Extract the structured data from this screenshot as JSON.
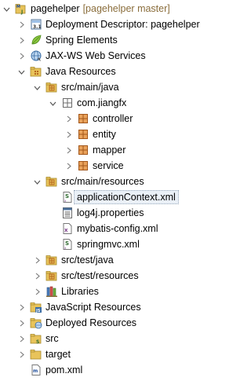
{
  "project": {
    "name": "pagehelper",
    "decoration": "[pagehelper master]"
  },
  "nodes": {
    "deployment_descriptor": "Deployment Descriptor: pagehelper",
    "spring_elements": "Spring Elements",
    "jaxws": "JAX-WS Web Services",
    "java_resources": "Java Resources",
    "src_main_java": "src/main/java",
    "pkg_com_jiangfx": "com.jiangfx",
    "pkg_controller": "controller",
    "pkg_entity": "entity",
    "pkg_mapper": "mapper",
    "pkg_service": "service",
    "src_main_resources": "src/main/resources",
    "application_context": "applicationContext.xml",
    "log4j": "log4j.properties",
    "mybatis_config": "mybatis-config.xml",
    "springmvc": "springmvc.xml",
    "src_test_java": "src/test/java",
    "src_test_resources": "src/test/resources",
    "libraries": "Libraries",
    "javascript_resources": "JavaScript Resources",
    "deployed_resources": "Deployed Resources",
    "src": "src",
    "target": "target",
    "pom": "pom.xml"
  },
  "icons": {
    "project": "maven-web-project-icon",
    "deployment_descriptor": "deployment-descriptor-icon",
    "spring": "spring-leaf-icon",
    "jaxws": "web-services-icon",
    "java_resources": "java-resources-icon",
    "source_folder": "source-folder-icon",
    "package": "package-icon",
    "xml_spring": "spring-xml-file-icon",
    "properties": "properties-file-icon",
    "xml": "xml-file-icon",
    "library": "library-icon",
    "js_resources": "javascript-resources-icon",
    "deployed": "deployed-resources-icon",
    "folder": "folder-icon",
    "pom": "pom-file-icon"
  },
  "colors": {
    "selection_background": "#eaf0f7",
    "decoration_text": "#8a6d3b",
    "folder_yellow": "#e8c35a",
    "package_brown": "#b5651d",
    "spring_green": "#6db33f"
  },
  "selected_node": "applicationContext.xml"
}
